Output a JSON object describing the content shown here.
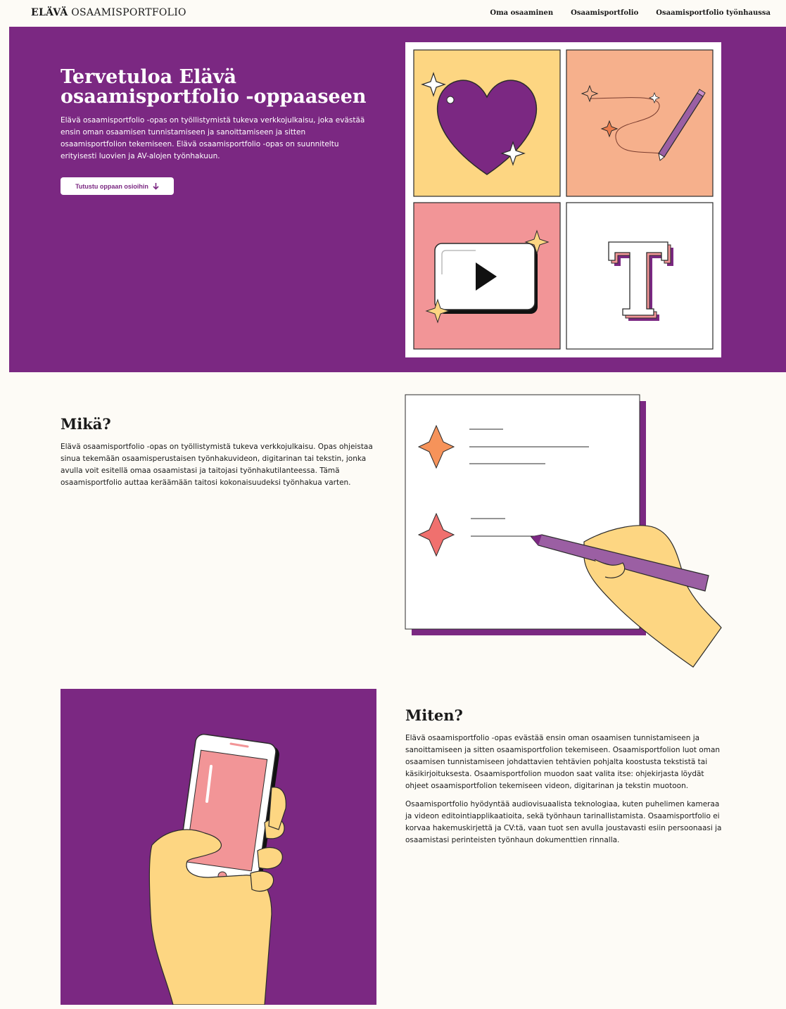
{
  "header": {
    "brand_bold": "ELÄVÄ",
    "brand_rest": "OSAAMISPORTFOLIO",
    "nav": [
      {
        "label": "Oma osaaminen"
      },
      {
        "label": "Osaamisportfolio"
      },
      {
        "label": "Osaamisportfolio työnhaussa"
      }
    ]
  },
  "hero": {
    "title": "Tervetuloa Elävä osaamisportfolio -oppaaseen",
    "text": "Elävä osaamisportfolio -opas on työllistymistä tukeva verkkojulkaisu, joka evästää ensin oman osaamisen tunnistamiseen ja sanoittamiseen ja sitten osaamisportfolion tekemiseen. Elävä osaamisportfolio -opas on suunniteltu erityisesti luovien ja AV-alojen työnhakuun.",
    "cta": "Tutustu oppaan osioihin",
    "cta_icon": "arrow-down-icon",
    "art_tiles": [
      "heart-icon",
      "pencil-icon",
      "video-play-icon",
      "text-t-icon"
    ]
  },
  "mika": {
    "title": "Mikä?",
    "text": "Elävä osaamisportfolio -opas on työllistymistä tukeva verkkojulkaisu. Opas ohjeistaa sinua tekemään osaamisperustaisen työnhakuvideon, digitarinan tai tekstin, jonka avulla voit esitellä omaa osaamistasi ja taitojasi työnhakutilanteessa. Tämä osaamisportfolio auttaa keräämään taitosi kokonaisuudeksi työnhakua varten."
  },
  "miten": {
    "title": "Miten?",
    "paragraphs": [
      "Elävä osaamisportfolio -opas evästää ensin oman osaamisen tunnistamiseen ja sanoittamiseen ja sitten osaamisportfolion tekemiseen. Osaamisportfolion luot oman osaamisen tunnistamiseen johdattavien tehtävien pohjalta koostusta tekstistä tai käsikirjoituksesta. Osaamisportfolion muodon saat valita itse: ohjekirjasta löydät ohjeet osaamisportfolion tekemiseen videon, digitarinan ja tekstin muotoon.",
      "Osaamisportfolio hyödyntää audiovisuaalista teknologiaa, kuten puhelimen kameraa ja videon editointiapplikaatioita, sekä työnhaun tarinallistamista. Osaamisportfolio ei korvaa hakemuskirjettä ja CV:tä, vaan tuot sen avulla joustavasti esiin persoonaasi ja osaamistasi perinteisten työnhaun dokumenttien rinnalla."
    ]
  },
  "colors": {
    "brand_purple": "#7b2882",
    "background": "#fdfbf6",
    "tile_yellow": "#fdd682",
    "tile_peach": "#f6b08c",
    "tile_pink": "#f29597",
    "hand_yellow": "#fdd682"
  }
}
